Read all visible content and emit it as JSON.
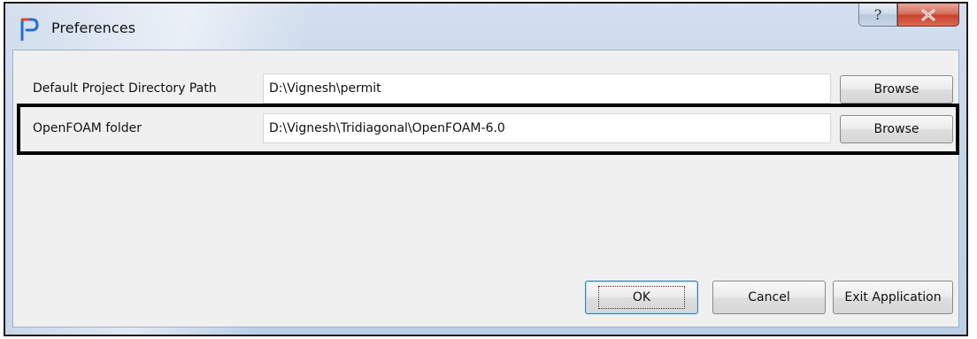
{
  "window": {
    "title": "Preferences",
    "help_glyph": "?",
    "close_icon": "close-icon",
    "app_icon": "app-p-logo-icon",
    "accent": "#1f6fd6"
  },
  "fields": {
    "project_dir": {
      "label": "Default Project Directory Path",
      "value": "D:\\Vignesh\\permit",
      "browse_label": "Browse"
    },
    "openfoam": {
      "label": "OpenFOAM folder",
      "value": "D:\\Vignesh\\Tridiagonal\\OpenFOAM-6.0",
      "browse_label": "Browse"
    }
  },
  "footer": {
    "ok_label": "OK",
    "cancel_label": "Cancel",
    "exit_label": "Exit Application"
  }
}
